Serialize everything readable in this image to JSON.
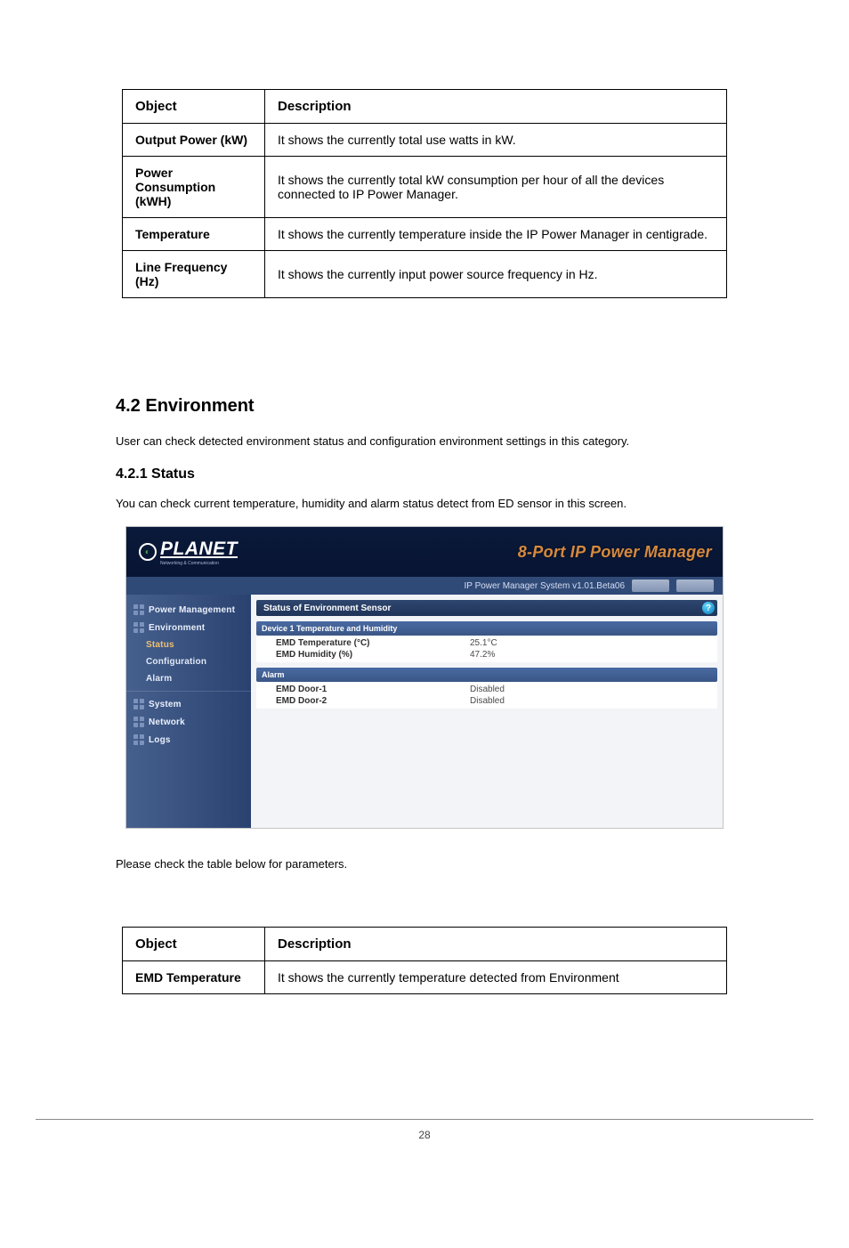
{
  "paramsTable": {
    "headers": [
      "Object",
      "Description"
    ],
    "rows": [
      {
        "label": "Output Power (kW)",
        "desc": "It shows the currently total use watts in kW."
      },
      {
        "label": "Power Consumption (kWH)",
        "desc": "It shows the currently total kW consumption per hour of all the devices connected to IP Power Manager."
      },
      {
        "label": "Temperature",
        "desc": "It shows the currently temperature inside the IP Power Manager in centigrade."
      },
      {
        "label": "Line Frequency (Hz)",
        "desc": "It shows the currently input power source frequency in Hz."
      }
    ]
  },
  "section": {
    "heading": "4.2 Environment",
    "intro": "User can check detected environment status and configuration environment settings in this category.",
    "sub_heading": "4.2.1 Status",
    "sub_intro": "You can check current temperature, humidity and alarm status detect from ED sensor in this screen."
  },
  "screenshot": {
    "brand": "PLANET",
    "brand_sub": "Networking & Communication",
    "header_title": "8-Port IP Power Manager",
    "topbar_text": "IP Power Manager System v1.01.Beta06",
    "sidebar": {
      "items": [
        {
          "label": "Power Management",
          "type": "top"
        },
        {
          "label": "Environment",
          "type": "top"
        },
        {
          "label": "Status",
          "type": "sub",
          "active": true
        },
        {
          "label": "Configuration",
          "type": "sub"
        },
        {
          "label": "Alarm",
          "type": "sub"
        },
        {
          "label": "System",
          "type": "top"
        },
        {
          "label": "Network",
          "type": "top"
        },
        {
          "label": "Logs",
          "type": "top"
        }
      ]
    },
    "content": {
      "title": "Status of Environment Sensor",
      "panels": [
        {
          "header": "Device 1 Temperature and Humidity",
          "rows": [
            {
              "key": "EMD Temperature (°C)",
              "val": "25.1°C"
            },
            {
              "key": "EMD Humidity (%)",
              "val": "47.2%"
            }
          ]
        },
        {
          "header": "Alarm",
          "rows": [
            {
              "key": "EMD Door-1",
              "val": "Disabled"
            },
            {
              "key": "EMD Door-2",
              "val": "Disabled"
            }
          ]
        }
      ]
    }
  },
  "secondParams": {
    "intro": "Please check the table below for parameters.",
    "headers": [
      "Object",
      "Description"
    ],
    "rows": [
      {
        "label": "EMD Temperature",
        "desc": "It shows the currently temperature detected from Environment"
      }
    ]
  },
  "page_number": "28"
}
